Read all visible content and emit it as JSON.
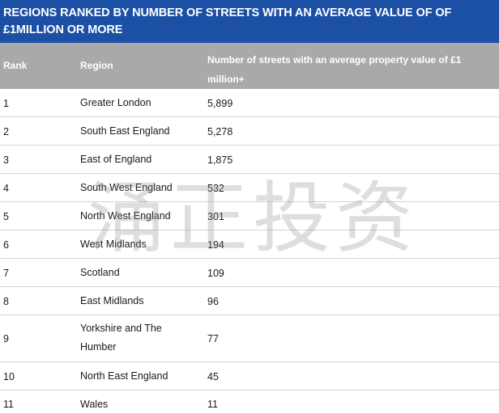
{
  "title": "REGIONS RANKED BY NUMBER OF STREETS WITH AN AVERAGE VALUE OF OF £1MILLION OR MORE",
  "columns": {
    "rank": "Rank",
    "region": "Region",
    "streets": "Number of streets with an average property value of £1 million+"
  },
  "rows": [
    {
      "rank": "1",
      "region": "Greater London",
      "streets": "5,899"
    },
    {
      "rank": "2",
      "region": "South East England",
      "streets": "5,278"
    },
    {
      "rank": "3",
      "region": "East of England",
      "streets": "1,875"
    },
    {
      "rank": "4",
      "region": "South West England",
      "streets": "532"
    },
    {
      "rank": "5",
      "region": "North West England",
      "streets": "301"
    },
    {
      "rank": "6",
      "region": "West Midlands",
      "streets": "194"
    },
    {
      "rank": "7",
      "region": "Scotland",
      "streets": "109"
    },
    {
      "rank": "8",
      "region": "East Midlands",
      "streets": "96"
    },
    {
      "rank": "9",
      "region": "Yorkshire and The Humber",
      "streets": "77"
    },
    {
      "rank": "10",
      "region": "North East England",
      "streets": "45"
    },
    {
      "rank": "11",
      "region": "Wales",
      "streets": "11"
    }
  ],
  "watermark": "涌正投资"
}
